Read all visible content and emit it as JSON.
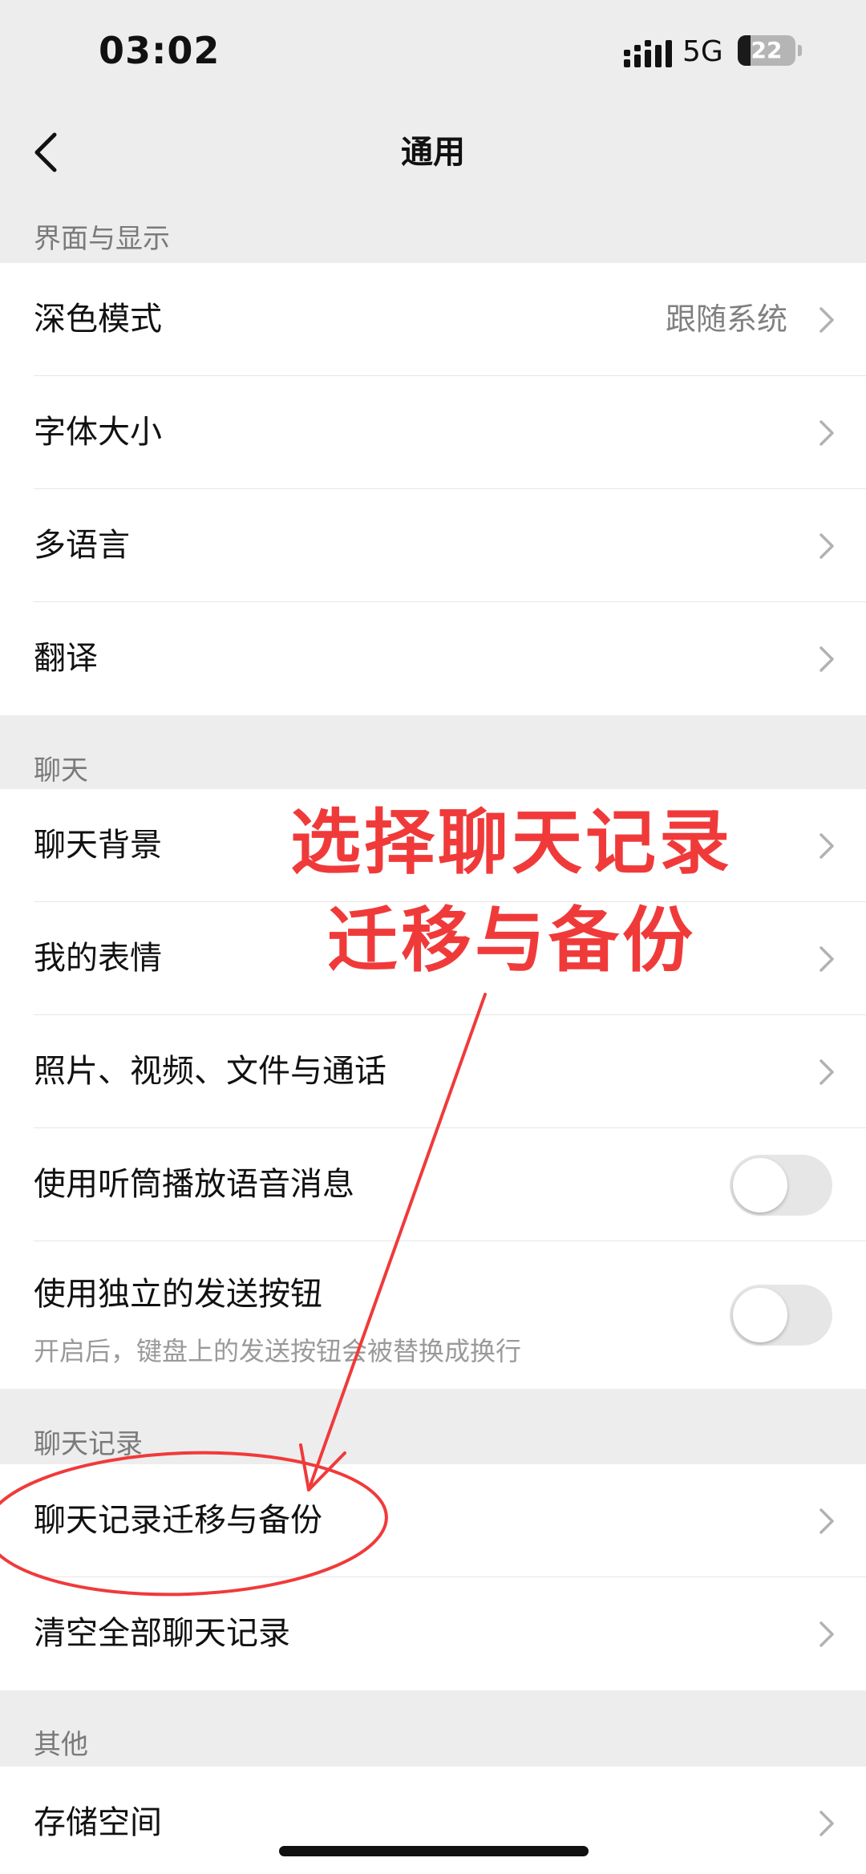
{
  "status_bar": {
    "time": "03:02",
    "network": "5G",
    "battery": "22",
    "battery_percent": 22
  },
  "navbar": {
    "title": "通用"
  },
  "sections": {
    "display": {
      "label": "界面与显示",
      "items": [
        {
          "label": "深色模式",
          "value": "跟随系统"
        },
        {
          "label": "字体大小"
        },
        {
          "label": "多语言"
        },
        {
          "label": "翻译"
        }
      ]
    },
    "chat": {
      "label": "聊天",
      "items": [
        {
          "label": "聊天背景"
        },
        {
          "label": "我的表情"
        },
        {
          "label": "照片、视频、文件与通话"
        },
        {
          "label": "使用听筒播放语音消息",
          "toggle": false
        },
        {
          "label": "使用独立的发送按钮",
          "sublabel": "开启后，键盘上的发送按钮会被替换成换行",
          "toggle": false
        }
      ]
    },
    "history": {
      "label": "聊天记录",
      "items": [
        {
          "label": "聊天记录迁移与备份"
        },
        {
          "label": "清空全部聊天记录"
        }
      ]
    },
    "other": {
      "label": "其他",
      "items": [
        {
          "label": "存储空间"
        }
      ]
    }
  },
  "annotation": {
    "line1": "选择聊天记录",
    "line2": "迁移与备份",
    "color": "#f03a3a"
  }
}
